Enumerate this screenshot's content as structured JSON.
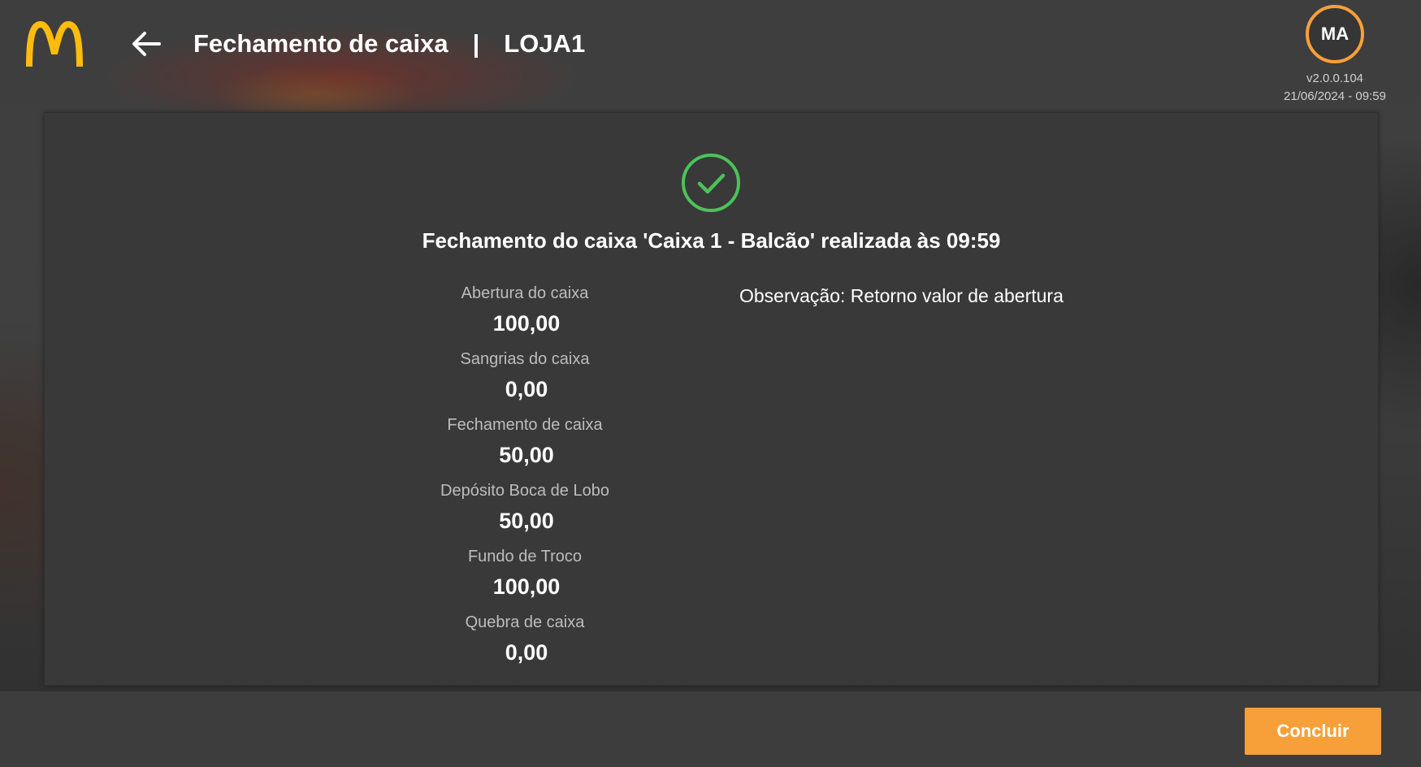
{
  "header": {
    "title": "Fechamento de caixa",
    "separator": "|",
    "store": "LOJA1",
    "back_icon": "arrow-left-icon",
    "logo": "mcdonalds-logo"
  },
  "user": {
    "initials": "MA",
    "version": "v2.0.0.104",
    "datetime": "21/06/2024 - 09:59"
  },
  "result": {
    "icon": "check-circle-icon",
    "title": "Fechamento do caixa 'Caixa 1 - Balcão' realizada às 09:59"
  },
  "summary": [
    {
      "label": "Abertura do caixa",
      "value": "100,00"
    },
    {
      "label": "Sangrias do caixa",
      "value": "0,00"
    },
    {
      "label": "Fechamento de caixa",
      "value": "50,00"
    },
    {
      "label": "Depósito Boca de Lobo",
      "value": "50,00"
    },
    {
      "label": "Fundo de Troco",
      "value": "100,00"
    },
    {
      "label": "Quebra de caixa",
      "value": "0,00"
    }
  ],
  "observation": "Observação: Retorno valor de abertura",
  "footer": {
    "conclude_label": "Concluir"
  },
  "colors": {
    "accent": "#f7a03a",
    "success": "#4cc25a",
    "logo_yellow": "#ffbc0d",
    "panel": "#393939"
  }
}
